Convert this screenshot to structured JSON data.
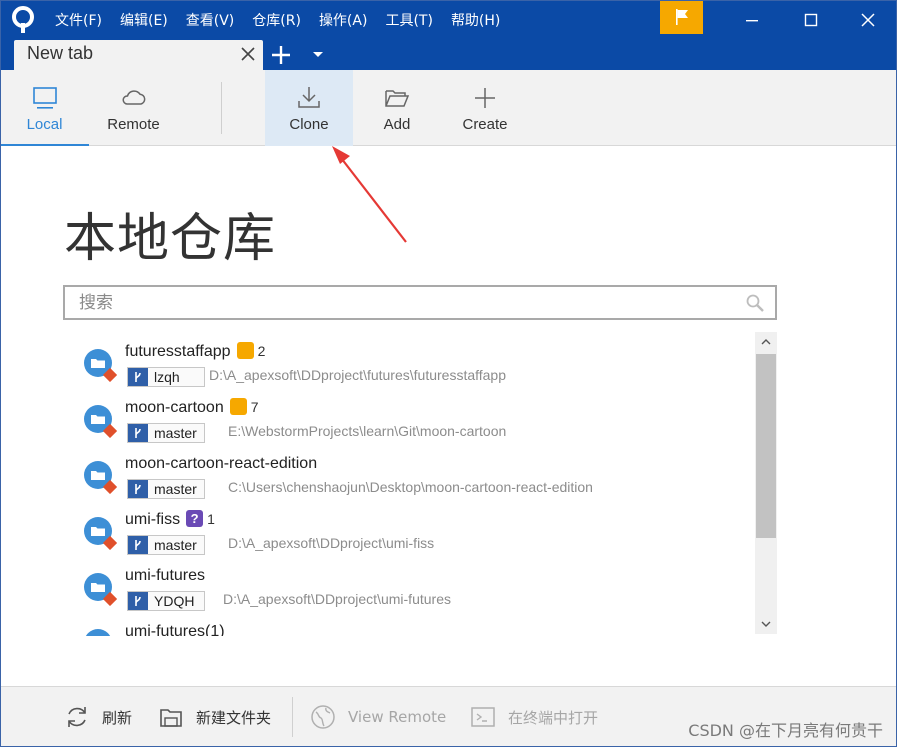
{
  "menu": [
    "文件(F)",
    "编辑(E)",
    "查看(V)",
    "仓库(R)",
    "操作(A)",
    "工具(T)",
    "帮助(H)"
  ],
  "tab": {
    "label": "New tab"
  },
  "toolbar": {
    "local": "Local",
    "remote": "Remote",
    "clone": "Clone",
    "add": "Add",
    "create": "Create"
  },
  "heading": "本地仓库",
  "search": {
    "placeholder": "搜索",
    "value": ""
  },
  "repos": [
    {
      "name": "futuresstaffapp",
      "badge": "pencil",
      "count": "2",
      "branch": "lzqh",
      "path": "D:\\A_apexsoft\\DDproject\\futures\\futuresstaffapp"
    },
    {
      "name": "moon-cartoon",
      "badge": "pencil",
      "count": "7",
      "branch": "master",
      "path": "E:\\WebstormProjects\\learn\\Git\\moon-cartoon"
    },
    {
      "name": "moon-cartoon-react-edition",
      "badge": "",
      "count": "",
      "branch": "master",
      "path": "C:\\Users\\chenshaojun\\Desktop\\moon-cartoon-react-edition"
    },
    {
      "name": "umi-fiss",
      "badge": "question",
      "count": "1",
      "branch": "master",
      "path": "D:\\A_apexsoft\\DDproject\\umi-fiss"
    },
    {
      "name": "umi-futures",
      "badge": "",
      "count": "",
      "branch": "YDQH",
      "path": "D:\\A_apexsoft\\DDproject\\umi-futures"
    },
    {
      "name": "umi-futures(1)",
      "badge": "",
      "count": "",
      "branch": "",
      "path": ""
    }
  ],
  "bottom": {
    "refresh": "刷新",
    "new_folder": "新建文件夹",
    "view_remote": "View Remote",
    "open_terminal": "在终端中打开"
  },
  "watermark": "CSDN @在下月亮有何贵干",
  "colors": {
    "title_bar": "#0b4aa6",
    "accent": "#2f86d6",
    "flag": "#f6a800",
    "arrow": "#e53935"
  }
}
